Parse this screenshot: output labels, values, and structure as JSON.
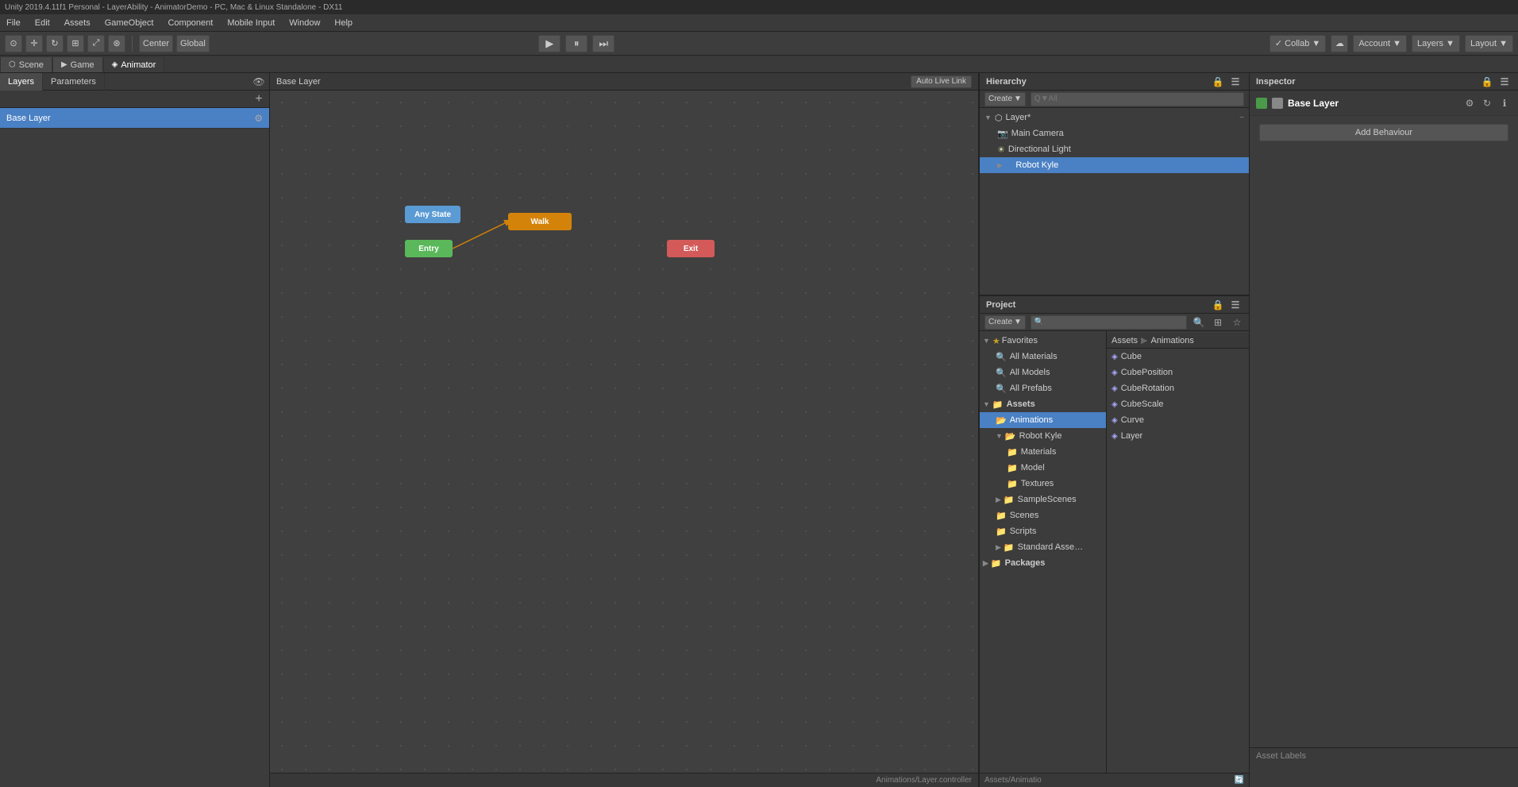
{
  "title_bar": {
    "text": "Unity 2019.4.11f1 Personal - LayerAbility - AnimatorDemo - PC, Mac & Linux Standalone - DX11"
  },
  "menu": {
    "items": [
      "File",
      "Edit",
      "Assets",
      "GameObject",
      "Component",
      "Mobile Input",
      "Window",
      "Help"
    ]
  },
  "toolbar": {
    "transform_btns": [
      "⊙",
      "+",
      "↻",
      "⊞",
      "⤢",
      "⊛"
    ],
    "center_label": "Center",
    "global_label": "Global",
    "play_label": "▶",
    "pause_label": "⏸",
    "step_label": "⏭",
    "collab_label": "✓ Collab ▼",
    "cloud_label": "☁",
    "account_label": "Account ▼",
    "layers_label": "Layers ▼",
    "layout_label": "Layout ▼"
  },
  "tabs": {
    "scene_label": "Scene",
    "game_label": "Game",
    "animator_label": "Animator"
  },
  "animator": {
    "panel_tabs": [
      "Layers",
      "Parameters"
    ],
    "base_layer_label": "Base Layer",
    "breadcrumb": "Base Layer",
    "auto_live_label": "Auto Live Link",
    "footer_text": "Animations/Layer.controller",
    "nodes": {
      "any_state": "Any State",
      "entry": "Entry",
      "walk": "Walk",
      "exit": "Exit"
    }
  },
  "hierarchy": {
    "title": "Hierarchy",
    "create_label": "Create",
    "search_placeholder": "Q▼All",
    "scene_name": "Layer*",
    "items": [
      {
        "name": "Main Camera",
        "indent": 1,
        "icon": "cam",
        "has_arrow": false
      },
      {
        "name": "Directional Light",
        "indent": 1,
        "icon": "light",
        "has_arrow": false
      },
      {
        "name": "Robot Kyle",
        "indent": 1,
        "icon": "robot",
        "has_arrow": true,
        "selected": true
      }
    ]
  },
  "inspector": {
    "title": "Inspector",
    "layer_name": "Base Layer",
    "swatch1": "#4a9a4a",
    "swatch2": "#888888",
    "add_behaviour_label": "Add Behaviour",
    "asset_labels_label": "Asset Labels"
  },
  "project": {
    "title": "Project",
    "create_label": "Create",
    "search_placeholder": "",
    "breadcrumb": {
      "assets": "Assets",
      "sep": "▶",
      "animations": "Animations"
    },
    "favorites": {
      "label": "Favorites",
      "items": [
        "All Materials",
        "All Models",
        "All Prefabs"
      ]
    },
    "assets": {
      "label": "Assets",
      "children": [
        {
          "name": "Animations",
          "selected": true,
          "expanded": false
        },
        {
          "name": "Robot Kyle",
          "expanded": true,
          "indent": 1,
          "children": [
            {
              "name": "Materials",
              "indent": 2
            },
            {
              "name": "Model",
              "indent": 2
            },
            {
              "name": "Textures",
              "indent": 2
            }
          ]
        },
        {
          "name": "SampleScenes",
          "indent": 1,
          "has_arrow": true
        },
        {
          "name": "Scenes",
          "indent": 1
        },
        {
          "name": "Scripts",
          "indent": 1
        },
        {
          "name": "Standard Assets",
          "indent": 1,
          "has_arrow": true
        }
      ]
    },
    "packages": {
      "label": "Packages"
    },
    "files": [
      {
        "name": "Cube"
      },
      {
        "name": "CubePosition"
      },
      {
        "name": "CubeRotation"
      },
      {
        "name": "CubeScale"
      },
      {
        "name": "Curve"
      },
      {
        "name": "Layer"
      }
    ],
    "footer_text": "Assets/Animatio"
  }
}
